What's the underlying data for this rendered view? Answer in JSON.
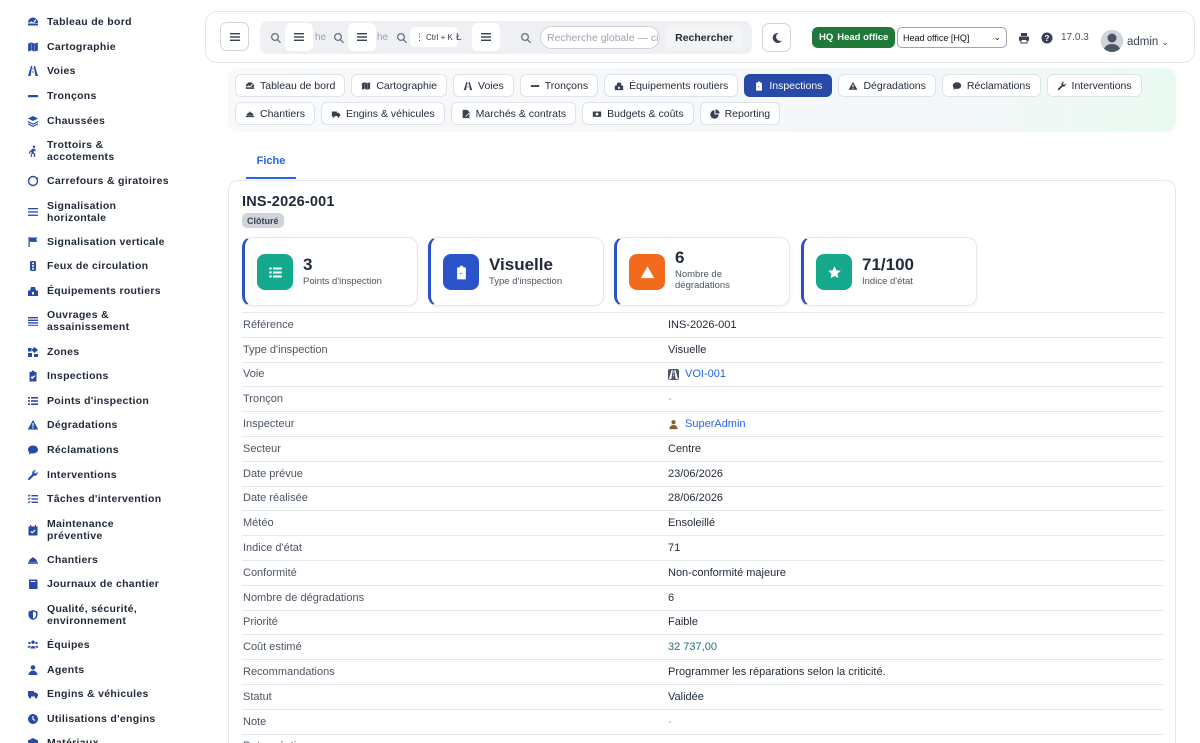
{
  "sidebar": {
    "items": [
      {
        "label": "Tableau de bord",
        "icon": "dashboard-icon"
      },
      {
        "label": "Cartographie",
        "icon": "map-icon"
      },
      {
        "label": "Voies",
        "icon": "road-icon"
      },
      {
        "label": "Tronçons",
        "icon": "segment-icon"
      },
      {
        "label": "Chaussées",
        "icon": "layers-icon"
      },
      {
        "label": "Trottoirs & accotements",
        "icon": "walking-icon"
      },
      {
        "label": "Carrefours & giratoires",
        "icon": "roundabout-icon"
      },
      {
        "label": "Signalisation horizontale",
        "icon": "road-marking-icon"
      },
      {
        "label": "Signalisation verticale",
        "icon": "sign-icon"
      },
      {
        "label": "Feux de circulation",
        "icon": "traffic-light-icon"
      },
      {
        "label": "Équipements routiers",
        "icon": "equipment-icon"
      },
      {
        "label": "Ouvrages & assainissement",
        "icon": "bars-icon"
      },
      {
        "label": "Zones",
        "icon": "zones-icon"
      },
      {
        "label": "Inspections",
        "icon": "clipboard-check-icon"
      },
      {
        "label": "Points d'inspection",
        "icon": "list-icon"
      },
      {
        "label": "Dégradations",
        "icon": "warning-icon"
      },
      {
        "label": "Réclamations",
        "icon": "comment-icon"
      },
      {
        "label": "Interventions",
        "icon": "wrench-icon"
      },
      {
        "label": "Tâches d'intervention",
        "icon": "tasks-icon"
      },
      {
        "label": "Maintenance préventive",
        "icon": "calendar-check-icon"
      },
      {
        "label": "Chantiers",
        "icon": "hard-hat-icon"
      },
      {
        "label": "Journaux de chantier",
        "icon": "book-icon"
      },
      {
        "label": "Qualité, sécurité, environnement",
        "icon": "shield-icon"
      },
      {
        "label": "Équipes",
        "icon": "users-icon"
      },
      {
        "label": "Agents",
        "icon": "user-icon"
      },
      {
        "label": "Engins & véhicules",
        "icon": "truck-icon"
      },
      {
        "label": "Utilisations d'engins",
        "icon": "clock-icon"
      },
      {
        "label": "Matériaux",
        "icon": "box-icon"
      }
    ]
  },
  "topbar": {
    "search_fragment_1": "he",
    "search_fragment_2": "he",
    "search_fragment_3": "Ł",
    "shortcut": "Ctrl + K",
    "global_search_placeholder": "Recherche globale — ci",
    "search_button": "Rechercher",
    "hq_code": "HQ",
    "hq_name": "Head office",
    "office_select": "Head office [HQ]",
    "version": "17.0.3",
    "username": "admin"
  },
  "modules": {
    "row1": [
      {
        "label": "Tableau de bord",
        "icon": "dashboard-icon",
        "active": false
      },
      {
        "label": "Cartographie",
        "icon": "map-icon",
        "active": false
      },
      {
        "label": "Voies",
        "icon": "road-icon",
        "active": false
      },
      {
        "label": "Tronçons",
        "icon": "segment-icon",
        "active": false
      },
      {
        "label": "Équipements routiers",
        "icon": "equipment-icon",
        "active": false
      },
      {
        "label": "Inspections",
        "icon": "clipboard-check-icon",
        "active": true
      },
      {
        "label": "Dégradations",
        "icon": "warning-icon",
        "active": false
      },
      {
        "label": "Réclamations",
        "icon": "comment-icon",
        "active": false
      },
      {
        "label": "Interventions",
        "icon": "wrench-icon",
        "active": false
      }
    ],
    "row2": [
      {
        "label": "Chantiers",
        "icon": "hard-hat-icon",
        "active": false
      },
      {
        "label": "Engins & véhicules",
        "icon": "truck-icon",
        "active": false
      },
      {
        "label": "Marchés & contrats",
        "icon": "contract-icon",
        "active": false
      },
      {
        "label": "Budgets & coûts",
        "icon": "money-icon",
        "active": false
      },
      {
        "label": "Reporting",
        "icon": "pie-chart-icon",
        "active": false
      }
    ]
  },
  "tabs": {
    "fiche": "Fiche"
  },
  "record": {
    "title": "INS-2026-001",
    "status": "Clôturé"
  },
  "kpis": [
    {
      "value": "3",
      "label": "Points d'inspection",
      "icon": "list-icon",
      "color": "#14a88c"
    },
    {
      "value": "Visuelle",
      "label": "Type d'inspection",
      "icon": "clipboard-check-icon",
      "color": "#2a52c9"
    },
    {
      "value": "6",
      "label": "Nombre de dégradations",
      "icon": "warning-icon",
      "color": "#f26b1d"
    },
    {
      "value": "71/100",
      "label": "Indice d'état",
      "icon": "star-icon",
      "color": "#14a88c"
    }
  ],
  "details": [
    {
      "key": "Référence",
      "value": "INS-2026-001",
      "type": "text"
    },
    {
      "key": "Type d'inspection",
      "value": "Visuelle",
      "type": "text"
    },
    {
      "key": "Voie",
      "value": "VOI-001",
      "type": "link",
      "icon": "road-icon"
    },
    {
      "key": "Tronçon",
      "value": "-",
      "type": "muted"
    },
    {
      "key": "Inspecteur",
      "value": "SuperAdmin",
      "type": "link",
      "icon": "user-icon"
    },
    {
      "key": "Secteur",
      "value": "Centre",
      "type": "text"
    },
    {
      "key": "Date prévue",
      "value": "23/06/2026",
      "type": "text"
    },
    {
      "key": "Date réalisée",
      "value": "28/06/2026",
      "type": "text"
    },
    {
      "key": "Météo",
      "value": "Ensoleillé",
      "type": "text"
    },
    {
      "key": "Indice d'état",
      "value": "71",
      "type": "text"
    },
    {
      "key": "Conformité",
      "value": "Non-conformité majeure",
      "type": "text"
    },
    {
      "key": "Nombre de dégradations",
      "value": "6",
      "type": "text"
    },
    {
      "key": "Priorité",
      "value": "Faible",
      "type": "text"
    },
    {
      "key": "Coût estimé",
      "value": "32 737,00",
      "type": "money"
    },
    {
      "key": "Recommandations",
      "value": "Programmer les réparations selon la criticité.",
      "type": "text"
    },
    {
      "key": "Statut",
      "value": "Validée",
      "type": "text"
    },
    {
      "key": "Note",
      "value": "-",
      "type": "muted"
    },
    {
      "key": "Date création",
      "value": "",
      "type": "text"
    }
  ],
  "colors": {
    "primary": "#2749a8",
    "link": "#2563eb",
    "hq_green": "#1f7a3a"
  }
}
